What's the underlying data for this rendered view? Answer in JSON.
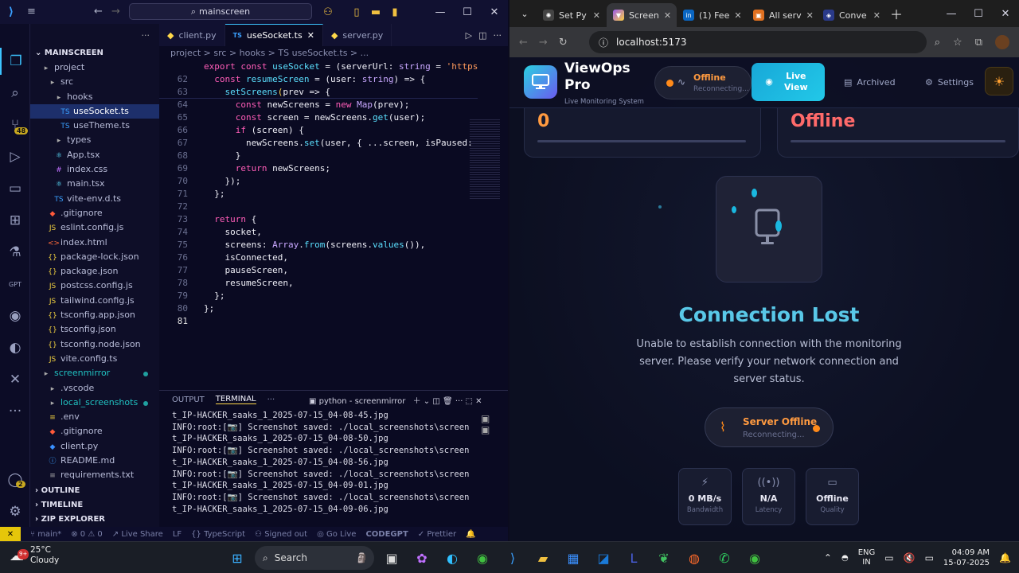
{
  "vscode": {
    "search_text": "mainscreen",
    "explorer_title": "MAINSCREEN",
    "tree": [
      {
        "label": "project",
        "icon": "folder-icon",
        "indent": 1,
        "modified": false
      },
      {
        "label": "src",
        "icon": "folder-icon",
        "indent": 2,
        "modified": false
      },
      {
        "label": "hooks",
        "icon": "folder-icon",
        "indent": 3,
        "modified": false
      },
      {
        "label": "useSocket.ts",
        "icon": "ts-file-icon",
        "indent": 4,
        "selected": true,
        "modified": false
      },
      {
        "label": "useTheme.ts",
        "icon": "ts-file-icon",
        "indent": 4,
        "modified": false
      },
      {
        "label": "types",
        "icon": "folder-icon",
        "indent": 3,
        "modified": false
      },
      {
        "label": "App.tsx",
        "icon": "react-file-icon",
        "indent": 3,
        "modified": false
      },
      {
        "label": "index.css",
        "icon": "css-file-icon",
        "indent": 3,
        "modified": false
      },
      {
        "label": "main.tsx",
        "icon": "react-file-icon",
        "indent": 3,
        "modified": false
      },
      {
        "label": "vite-env.d.ts",
        "icon": "ts-file-icon",
        "indent": 3,
        "modified": false
      },
      {
        "label": ".gitignore",
        "icon": "git-file-icon",
        "indent": 2,
        "modified": false
      },
      {
        "label": "eslint.config.js",
        "icon": "js-file-icon",
        "indent": 2,
        "modified": false
      },
      {
        "label": "index.html",
        "icon": "html-file-icon",
        "indent": 2,
        "modified": false
      },
      {
        "label": "package-lock.json",
        "icon": "json-file-icon",
        "indent": 2,
        "modified": false
      },
      {
        "label": "package.json",
        "icon": "json-file-icon",
        "indent": 2,
        "modified": false
      },
      {
        "label": "postcss.config.js",
        "icon": "js-file-icon",
        "indent": 2,
        "modified": false
      },
      {
        "label": "tailwind.config.js",
        "icon": "js-file-icon",
        "indent": 2,
        "modified": false
      },
      {
        "label": "tsconfig.app.json",
        "icon": "json-file-icon",
        "indent": 2,
        "modified": false
      },
      {
        "label": "tsconfig.json",
        "icon": "json-file-icon",
        "indent": 2,
        "modified": false
      },
      {
        "label": "tsconfig.node.json",
        "icon": "json-file-icon",
        "indent": 2,
        "modified": false
      },
      {
        "label": "vite.config.ts",
        "icon": "js-file-icon",
        "indent": 2,
        "modified": false
      },
      {
        "label": "screenmirror",
        "icon": "folder-icon",
        "indent": 1,
        "modified": true
      },
      {
        "label": ".vscode",
        "icon": "folder-icon",
        "indent": 2,
        "modified": false
      },
      {
        "label": "local_screenshots",
        "icon": "folder-icon",
        "indent": 2,
        "modified": true
      },
      {
        "label": ".env",
        "icon": "env-file-icon",
        "indent": 2,
        "modified": false
      },
      {
        "label": ".gitignore",
        "icon": "git-file-icon",
        "indent": 2,
        "modified": false
      },
      {
        "label": "client.py",
        "icon": "python-file-icon",
        "indent": 2,
        "modified": false
      },
      {
        "label": "README.md",
        "icon": "info-file-icon",
        "indent": 2,
        "modified": false
      },
      {
        "label": "requirements.txt",
        "icon": "text-file-icon",
        "indent": 2,
        "modified": false
      }
    ],
    "sections": [
      "OUTLINE",
      "TIMELINE",
      "ZIP EXPLORER"
    ],
    "tabs": [
      {
        "label": "client.py",
        "active": false
      },
      {
        "label": "useSocket.ts",
        "active": true
      },
      {
        "label": "server.py",
        "active": false
      }
    ],
    "breadcrumb": "project > src > hooks > TS useSocket.ts > ...",
    "sticky_lines": [
      {
        "n": "",
        "html": "export const useSocket = (serverUrl: string = 'https"
      },
      {
        "n": "62",
        "html": "  const resumeScreen = (user: string) => {"
      },
      {
        "n": "63",
        "html": "    setScreens(prev => {"
      }
    ],
    "code_lines": [
      {
        "n": "64",
        "text": "      const newScreens = new Map(prev);"
      },
      {
        "n": "65",
        "text": "      const screen = newScreens.get(user);"
      },
      {
        "n": "66",
        "text": "      if (screen) {"
      },
      {
        "n": "67",
        "text": "        newScreens.set(user, { ...screen, isPaused: "
      },
      {
        "n": "68",
        "text": "      }"
      },
      {
        "n": "69",
        "text": "      return newScreens;"
      },
      {
        "n": "70",
        "text": "    });"
      },
      {
        "n": "71",
        "text": "  };"
      },
      {
        "n": "72",
        "text": ""
      },
      {
        "n": "73",
        "text": "  return {"
      },
      {
        "n": "74",
        "text": "    socket,"
      },
      {
        "n": "75",
        "text": "    screens: Array.from(screens.values()),"
      },
      {
        "n": "76",
        "text": "    isConnected,"
      },
      {
        "n": "77",
        "text": "    pauseScreen,"
      },
      {
        "n": "78",
        "text": "    resumeScreen,"
      },
      {
        "n": "79",
        "text": "  };"
      },
      {
        "n": "80",
        "text": "};"
      },
      {
        "n": "81",
        "text": ""
      }
    ],
    "panel_tabs": [
      "OUTPUT",
      "TERMINAL",
      "···"
    ],
    "terminal_name": "python - screenmirror",
    "terminal_lines": [
      "t_IP-HACKER_saaks_1_2025-07-15_04-08-45.jpg",
      "INFO:root:[📷] Screenshot saved: ./local_screenshots\\screensho",
      "t_IP-HACKER_saaks_1_2025-07-15_04-08-50.jpg",
      "INFO:root:[📷] Screenshot saved: ./local_screenshots\\screensho",
      "t_IP-HACKER_saaks_1_2025-07-15_04-08-56.jpg",
      "INFO:root:[📷] Screenshot saved: ./local_screenshots\\screensho",
      "t_IP-HACKER_saaks_1_2025-07-15_04-09-01.jpg",
      "INFO:root:[📷] Screenshot saved: ./local_screenshots\\screensho",
      "t_IP-HACKER_saaks_1_2025-07-15_04-09-06.jpg"
    ],
    "status": {
      "branch": "main*",
      "problems": "⊗ 0 ⚠ 0",
      "live_share": "Live Share",
      "eol": "LF",
      "language": "TypeScript",
      "signed_out": "Signed out",
      "go_live": "Go Live",
      "codegpt": "CODEGPT",
      "prettier": "Prettier"
    },
    "badges": {
      "source_control": "48",
      "accounts": "2"
    }
  },
  "browser": {
    "tabs": [
      {
        "label": "Set Py",
        "icon": "chatgpt-icon",
        "active": false
      },
      {
        "label": "Screen",
        "icon": "vite-icon",
        "active": true
      },
      {
        "label": "(1) Fee",
        "icon": "linkedin-icon",
        "active": false
      },
      {
        "label": "All serv",
        "icon": "aws-icon",
        "active": false
      },
      {
        "label": "Conve",
        "icon": "claude-icon",
        "active": false
      }
    ],
    "url": "localhost:5173"
  },
  "app": {
    "name": "ViewOps Pro",
    "subtitle": "Live Monitoring System",
    "status_title": "Offline",
    "status_sub": "Reconnecting...",
    "live_view": "Live View",
    "archived": "Archived",
    "settings": "Settings",
    "stat_left_value": "0",
    "stat_right_value": "Offline",
    "title": "Connection Lost",
    "description": "Unable to establish connection with the monitoring server. Please verify your network connection and server status.",
    "server_status_title": "Server Offline",
    "server_status_sub": "Reconnecting...",
    "metrics": [
      {
        "value": "0 MB/s",
        "label": "Bandwidth",
        "icon": "bolt-icon"
      },
      {
        "value": "N/A",
        "label": "Latency",
        "icon": "signal-icon"
      },
      {
        "value": "Offline",
        "label": "Quality",
        "icon": "monitor-icon"
      }
    ]
  },
  "taskbar": {
    "temperature": "25°C",
    "weather": "Cloudy",
    "weather_badge": "9+",
    "search_placeholder": "Search",
    "language": "ENG",
    "region": "IN",
    "time": "04:09 AM",
    "date": "15-07-2025"
  }
}
